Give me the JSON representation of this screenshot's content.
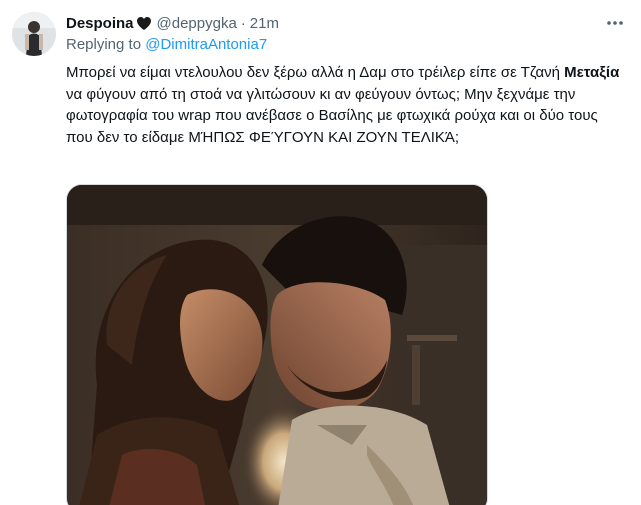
{
  "tweet": {
    "display_name": "Despoina",
    "handle": "@deppygka",
    "separator": "·",
    "time": "21m",
    "reply_prefix": "Replying to ",
    "reply_mention": "@DimitraAntonia7",
    "text_part1": "Μπορεί να είμαι ντελουλου δεν ξέρω αλλά η Δαμ στο τρέιλερ είπε σε Τζανή ",
    "text_bold": "Μεταξία",
    "text_part2": " να φύγουν από τη στοά να γλιτώσουν κι αν φεύγουν όντως; Μην ξεχνάμε την φωτογραφία του wrap που ανέβασε ο Βασίλης με φτωχικά ρούχα και οι δύο τους που δεν το είδαμε ΜΉΠΩΣ ΦΕΎΓΟΥΝ ΚΑΙ ΖΟΥΝ ΤΕΛΙΚΆ;"
  },
  "icons": {
    "heart": "black-heart-icon",
    "more": "more-options-icon"
  },
  "colors": {
    "link": "#1d9bf0",
    "secondary_text": "#536471",
    "primary_text": "#0f1419"
  }
}
